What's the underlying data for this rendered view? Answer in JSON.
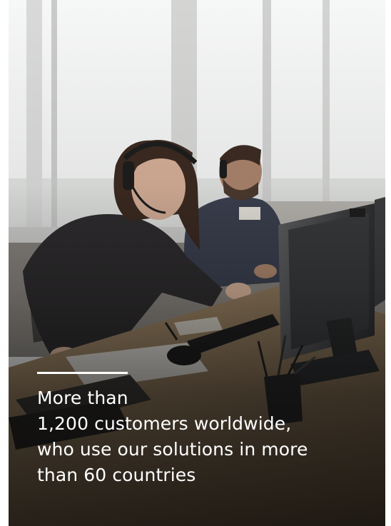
{
  "caption": {
    "line1": "More than",
    "line2": "1,200 customers worldwide,",
    "line3": "who use our solutions in more",
    "line4": "than 60 countries"
  },
  "colors": {
    "text": "#ffffff",
    "accent_line": "#ffffff"
  }
}
